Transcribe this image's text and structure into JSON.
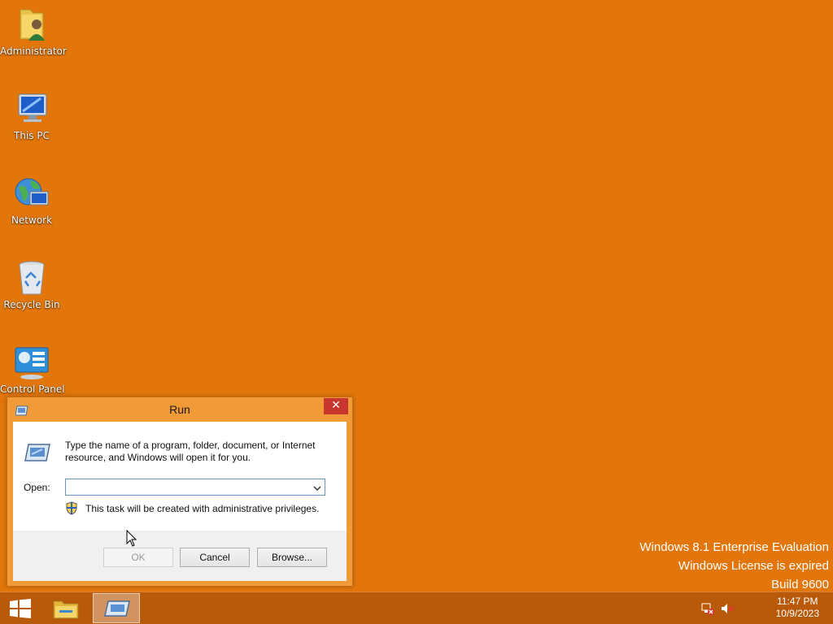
{
  "desktop": {
    "icons": [
      {
        "label": "Administrator",
        "icon": "user-folder-icon"
      },
      {
        "label": "This PC",
        "icon": "computer-icon"
      },
      {
        "label": "Network",
        "icon": "network-icon"
      },
      {
        "label": "Recycle Bin",
        "icon": "recycle-bin-icon"
      },
      {
        "label": "Control Panel",
        "icon": "control-panel-icon"
      }
    ],
    "background_color": "#e3760b"
  },
  "watermark": {
    "line1": "Windows 8.1 Enterprise Evaluation",
    "line2": "Windows License is expired",
    "line3": "Build 9600"
  },
  "run_dialog": {
    "title": "Run",
    "close_label": "✕",
    "description": "Type the name of a program, folder, document, or Internet resource, and Windows will open it for you.",
    "open_label": "Open:",
    "open_value": "",
    "admin_note": "This task will be created with administrative privileges.",
    "buttons": {
      "ok": "OK",
      "cancel": "Cancel",
      "browse": "Browse..."
    }
  },
  "taskbar": {
    "items": [
      {
        "name": "start-button",
        "icon": "windows-logo-icon"
      },
      {
        "name": "file-explorer",
        "icon": "folder-icon"
      },
      {
        "name": "run-task",
        "icon": "run-icon",
        "active": true
      }
    ],
    "clock": {
      "time": "11:47 PM",
      "date": "10/9/2023"
    },
    "tray": [
      "network-error-icon",
      "volume-muted-icon"
    ]
  }
}
